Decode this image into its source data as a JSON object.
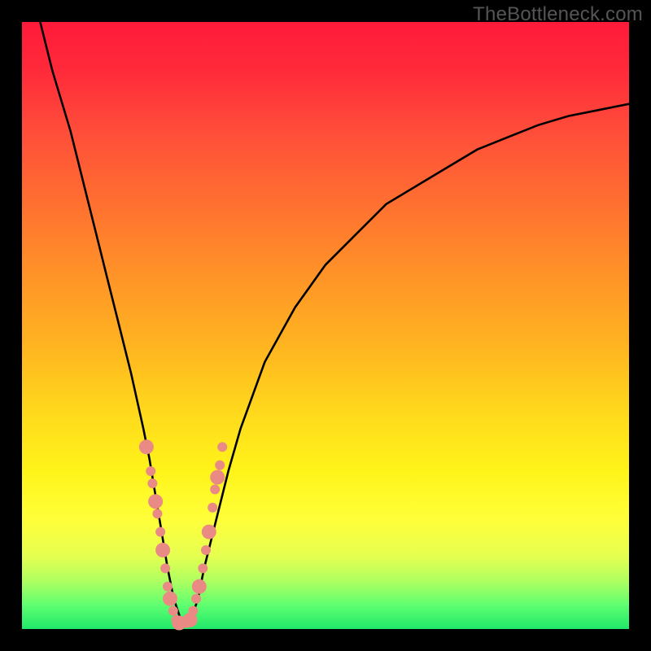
{
  "watermark": "TheBottleneck.com",
  "colors": {
    "frame": "#000000",
    "curve": "#000000",
    "marker": "#e98b84",
    "gradient_top": "#ff1a3a",
    "gradient_bottom": "#20e86a"
  },
  "chart_data": {
    "type": "line",
    "title": "",
    "xlabel": "",
    "ylabel": "",
    "xlim": [
      0,
      100
    ],
    "ylim": [
      0,
      100
    ],
    "series": [
      {
        "name": "bottleneck-curve",
        "x": [
          3,
          5,
          8,
          10,
          12,
          14,
          16,
          18,
          20,
          21,
          22,
          23,
          24,
          25,
          26,
          27,
          28,
          29,
          30,
          32,
          34,
          36,
          40,
          45,
          50,
          55,
          60,
          65,
          70,
          75,
          80,
          85,
          90,
          95,
          100
        ],
        "y": [
          100,
          92,
          82,
          74,
          66,
          58,
          50,
          42,
          33,
          28,
          22,
          16,
          10,
          5,
          2,
          1,
          2,
          5,
          10,
          18,
          26,
          33,
          44,
          53,
          60,
          65,
          70,
          73,
          76,
          79,
          81,
          83,
          84.5,
          85.5,
          86.5
        ]
      }
    ],
    "markers": {
      "name": "highlight-dots",
      "x": [
        20.5,
        21.2,
        21.5,
        22.0,
        22.3,
        22.8,
        23.2,
        23.6,
        24.0,
        24.4,
        24.9,
        25.4,
        25.9,
        26.5,
        27.1,
        27.7,
        28.2,
        28.7,
        29.2,
        29.8,
        30.3,
        30.8,
        31.4,
        31.8,
        32.2,
        32.6,
        33.0
      ],
      "y": [
        30,
        26,
        24,
        21,
        19,
        16,
        13,
        10,
        7,
        5,
        3,
        1.5,
        1,
        1,
        1,
        1.5,
        3,
        5,
        7,
        10,
        13,
        16,
        20,
        23,
        25,
        27,
        30
      ]
    }
  }
}
